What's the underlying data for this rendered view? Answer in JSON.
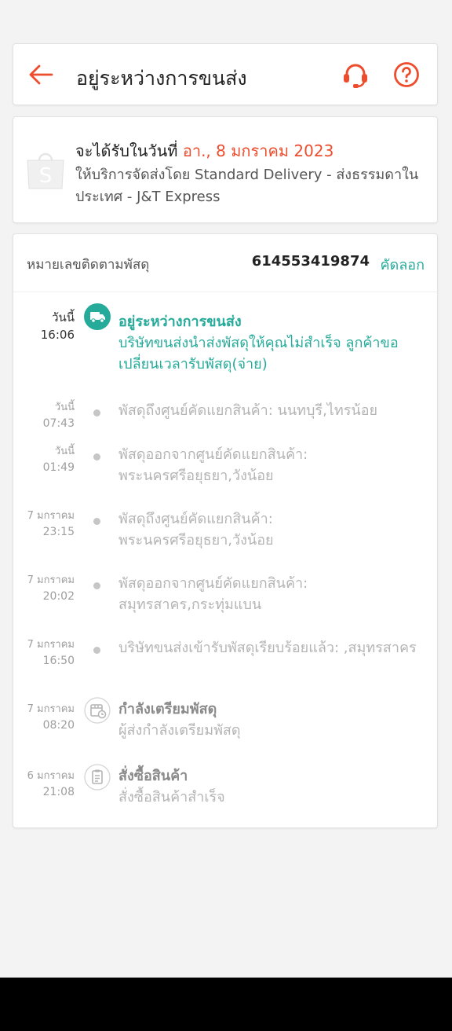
{
  "header": {
    "title": "อยู่ระหว่างการขนส่ง"
  },
  "delivery": {
    "eta_prefix": "จะได้รับในวันที่ ",
    "eta_date": "อา., 8 มกราคม 2023",
    "service": "ให้บริการจัดส่งโดย Standard Delivery - ส่งธรรมดาในประเทศ - J&T Express"
  },
  "tracking": {
    "label": "หมายเลขติดตามพัสดุ",
    "number": "614553419874",
    "copy_label": "คัดลอก"
  },
  "events": [
    {
      "date": "วันนี้",
      "time": "16:06",
      "title": "อยู่ระหว่างการขนส่ง",
      "desc": "บริษัทขนส่งนำส่งพัสดุให้คุณไม่สำเร็จ ลูกค้าขอเปลี่ยนเวลารับพัสดุ(จ่าย)"
    },
    {
      "date": "วันนี้",
      "time": "07:43",
      "desc": "พัสดุถึงศูนย์คัดแยกสินค้า: นนทบุรี,ไทรน้อย"
    },
    {
      "date": "วันนี้",
      "time": "01:49",
      "desc": "พัสดุออกจากศูนย์คัดแยกสินค้า: พระนครศรีอยุธยา,วังน้อย"
    },
    {
      "date": "7 มกราคม",
      "time": "23:15",
      "desc": "พัสดุถึงศูนย์คัดแยกสินค้า: พระนครศรีอยุธยา,วังน้อย"
    },
    {
      "date": "7 มกราคม",
      "time": "20:02",
      "desc": "พัสดุออกจากศูนย์คัดแยกสินค้า: สมุทรสาคร,กระทุ่มแบน"
    },
    {
      "date": "7 มกราคม",
      "time": "16:50",
      "desc": "บริษัทขนส่งเข้ารับพัสดุเรียบร้อยแล้ว: ,สมุทรสาคร"
    },
    {
      "date": "7 มกราคม",
      "time": "08:20",
      "title": "กำลังเตรียมพัสดุ",
      "desc": "ผู้ส่งกำลังเตรียมพัสดุ"
    },
    {
      "date": "6 มกราคม",
      "time": "21:08",
      "title": "สั่งซื้อสินค้า",
      "desc": "สั่งซื้อสินค้าสำเร็จ"
    }
  ],
  "colors": {
    "brand": "#ee4d2d",
    "teal": "#26aa99",
    "muted": "#b4b4b4"
  }
}
